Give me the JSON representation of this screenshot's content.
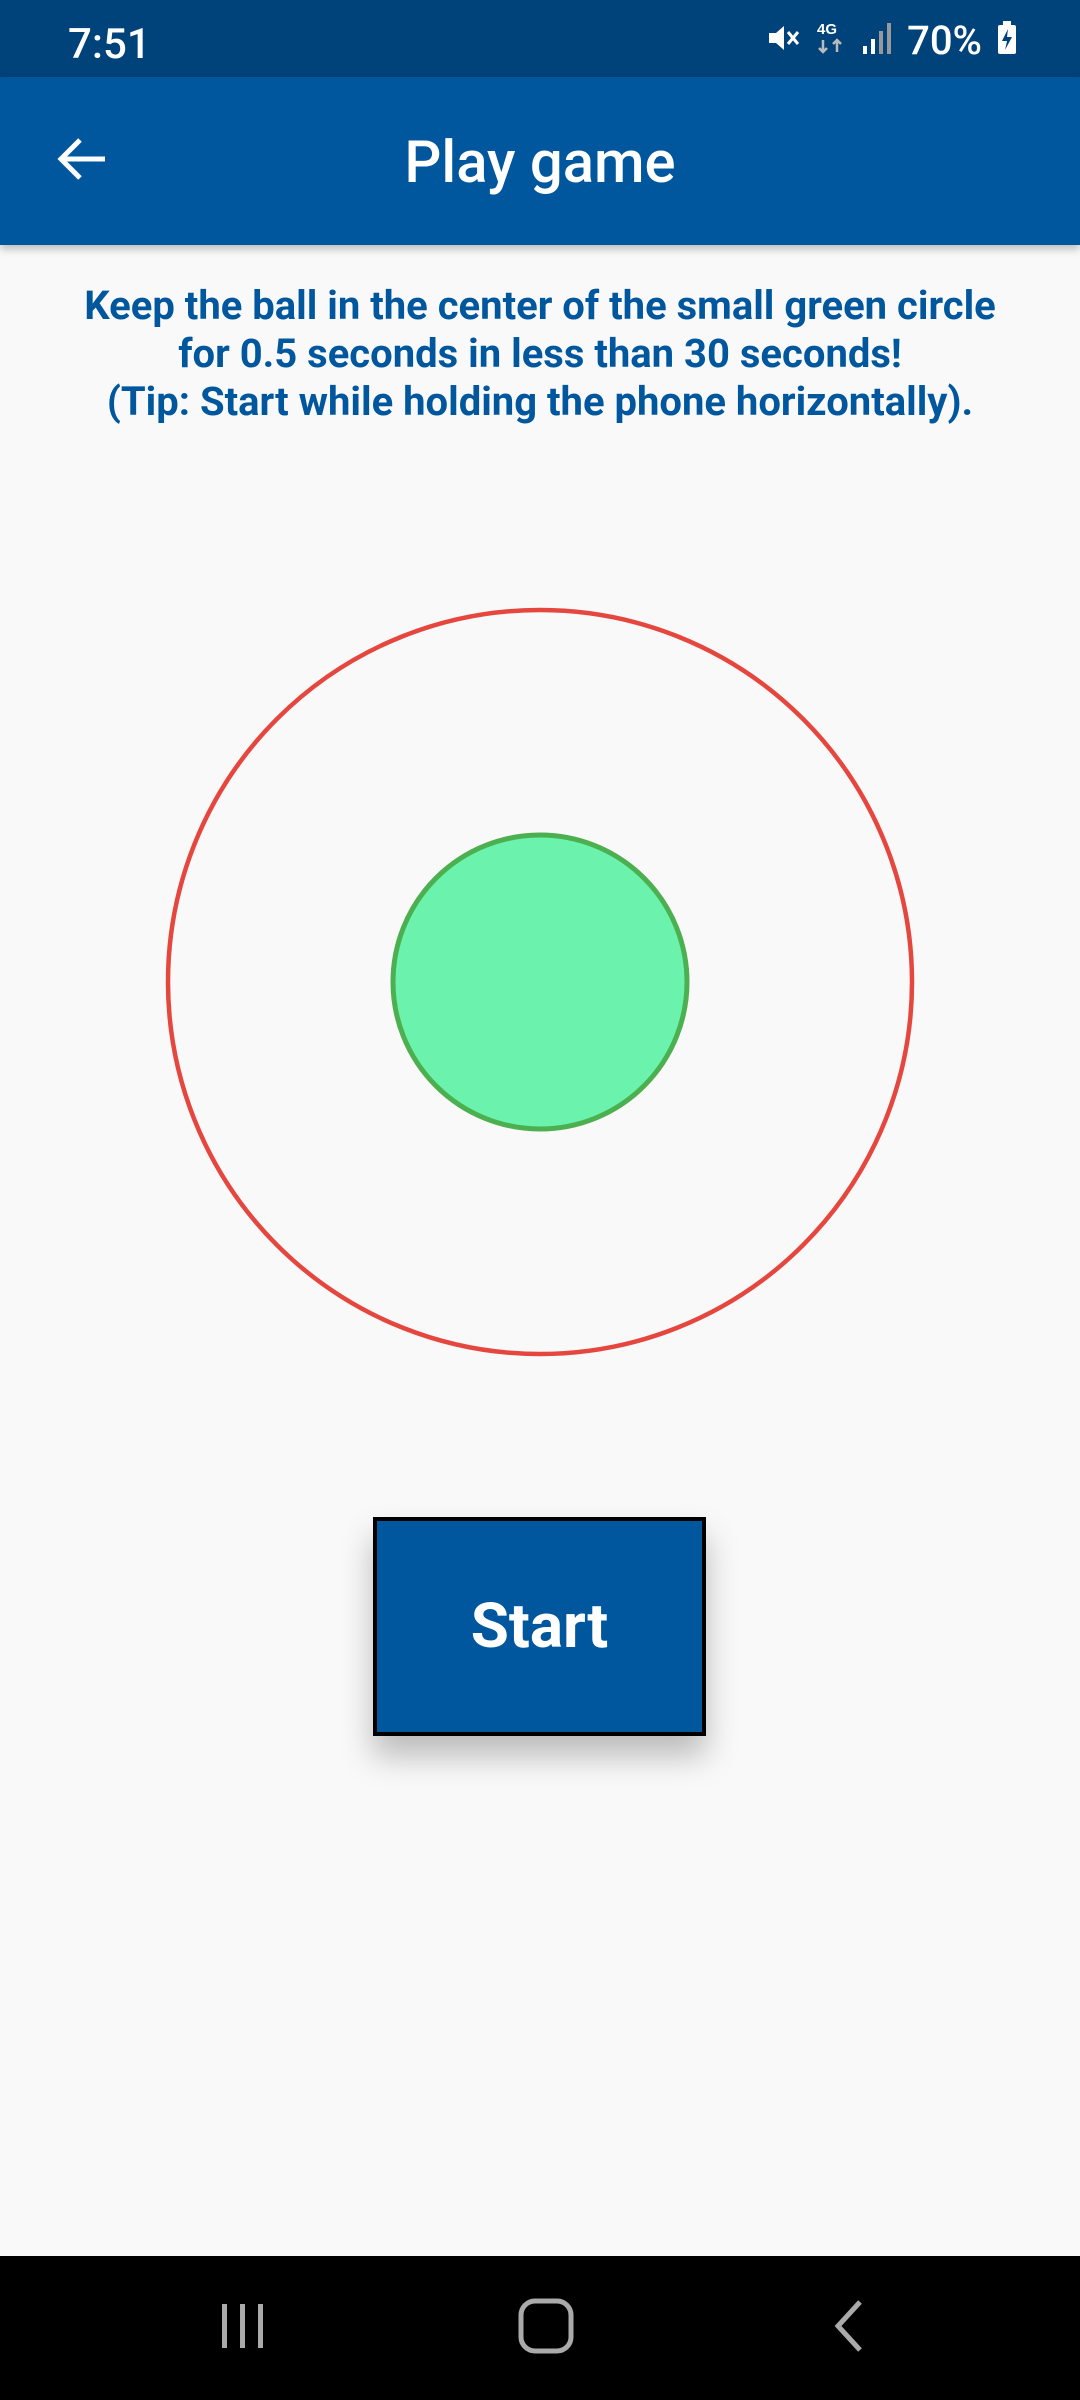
{
  "status_bar": {
    "time": "7:51",
    "battery": "70%",
    "icons": [
      "mute-icon",
      "4g-data-icon",
      "signal-icon",
      "battery-charging-icon"
    ]
  },
  "app_bar": {
    "title": "Play game",
    "back_icon": "arrow-back-icon"
  },
  "instructions": {
    "line1": "Keep the ball in the center of the small green circle",
    "line2": "for 0.5 seconds in less than 30 seconds!",
    "line3": "(Tip: Start while holding the phone horizontally)."
  },
  "game": {
    "outer_circle_color": "#e5473f",
    "inner_circle_fill": "#6bf2ad",
    "inner_circle_stroke": "#4caf50"
  },
  "start_button": {
    "label": "Start"
  },
  "nav_bar": {
    "items": [
      "recents-icon",
      "home-icon",
      "back-icon"
    ]
  },
  "colors": {
    "primary": "#00579e",
    "status_bar": "#00427a",
    "background": "#f9f9f9"
  }
}
